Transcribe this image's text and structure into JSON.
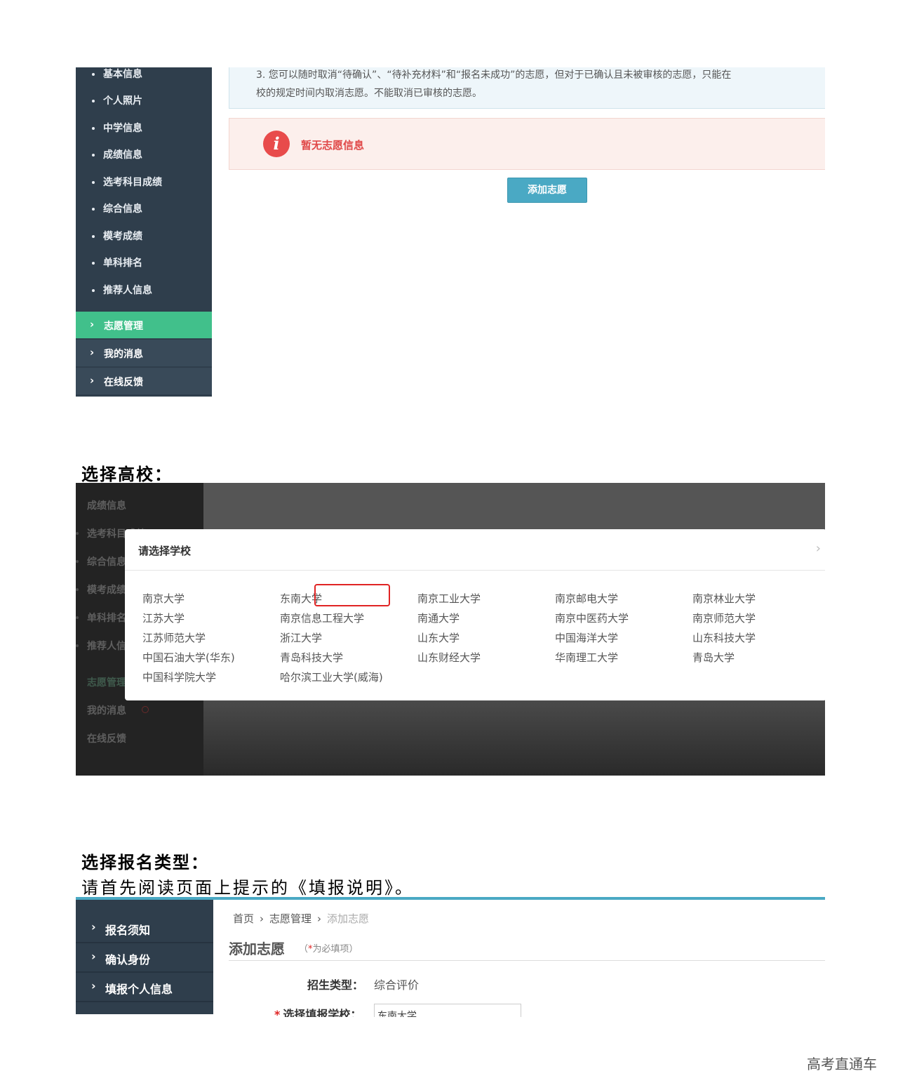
{
  "shot1": {
    "sidebar_sub_items": [
      "基本信息",
      "个人照片",
      "中学信息",
      "成绩信息",
      "选考科目成绩",
      "综合信息",
      "模考成绩",
      "单科排名",
      "推荐人信息"
    ],
    "sidebar_main_items": [
      "志愿管理",
      "我的消息",
      "在线反馈"
    ],
    "notice_line1": "3. 您可以随时取消“待确认”、“待补充材料”和“报名未成功”的志愿，但对于已确认且未被审核的志愿，只能在",
    "notice_line2": "校的规定时间内取消志愿。不能取消已审核的志愿。",
    "alert_text": "暂无志愿信息",
    "add_button": "添加志愿"
  },
  "heading_select_school": "选择高校：",
  "shot2": {
    "bg_sidebar_items": [
      "成绩信息",
      "选考科目成绩",
      "综合信息",
      "模考成绩",
      "单科排名",
      "推荐人信息",
      "志愿管理",
      "我的消息",
      "在线反馈"
    ],
    "modal_title": "请选择学校",
    "schools": [
      [
        "南京大学",
        "东南大学",
        "南京工业大学",
        "南京邮电大学",
        "南京林业大学"
      ],
      [
        "江苏大学",
        "南京信息工程大学",
        "南通大学",
        "南京中医药大学",
        "南京师范大学"
      ],
      [
        "江苏师范大学",
        "浙江大学",
        "山东大学",
        "中国海洋大学",
        "山东科技大学"
      ],
      [
        "中国石油大学(华东)",
        "青岛科技大学",
        "山东财经大学",
        "华南理工大学",
        "青岛大学"
      ],
      [
        "中国科学院大学",
        "哈尔滨工业大学(威海)"
      ]
    ]
  },
  "heading_select_type": "选择报名类型：",
  "instruction": "请首先阅读页面上提示的《填报说明》。",
  "shot3": {
    "sidebar_items": [
      "报名须知",
      "确认身份",
      "填报个人信息"
    ],
    "breadcrumb": [
      "首页",
      "志愿管理",
      "添加志愿"
    ],
    "page_title": "添加志愿",
    "required_hint_open": "（",
    "required_star": "*",
    "required_hint": "为必填项）",
    "type_label": "招生类型：",
    "type_value": "综合评价",
    "school_label_star": "*",
    "school_label": "选择填报学校：",
    "school_value": "东南大学"
  },
  "footer_watermark": "高考直通车",
  "colors": {
    "sidebar": "#2f3e4c",
    "active": "#41c08b",
    "accent": "#4aa9c4",
    "alert": "#e84b4b"
  }
}
